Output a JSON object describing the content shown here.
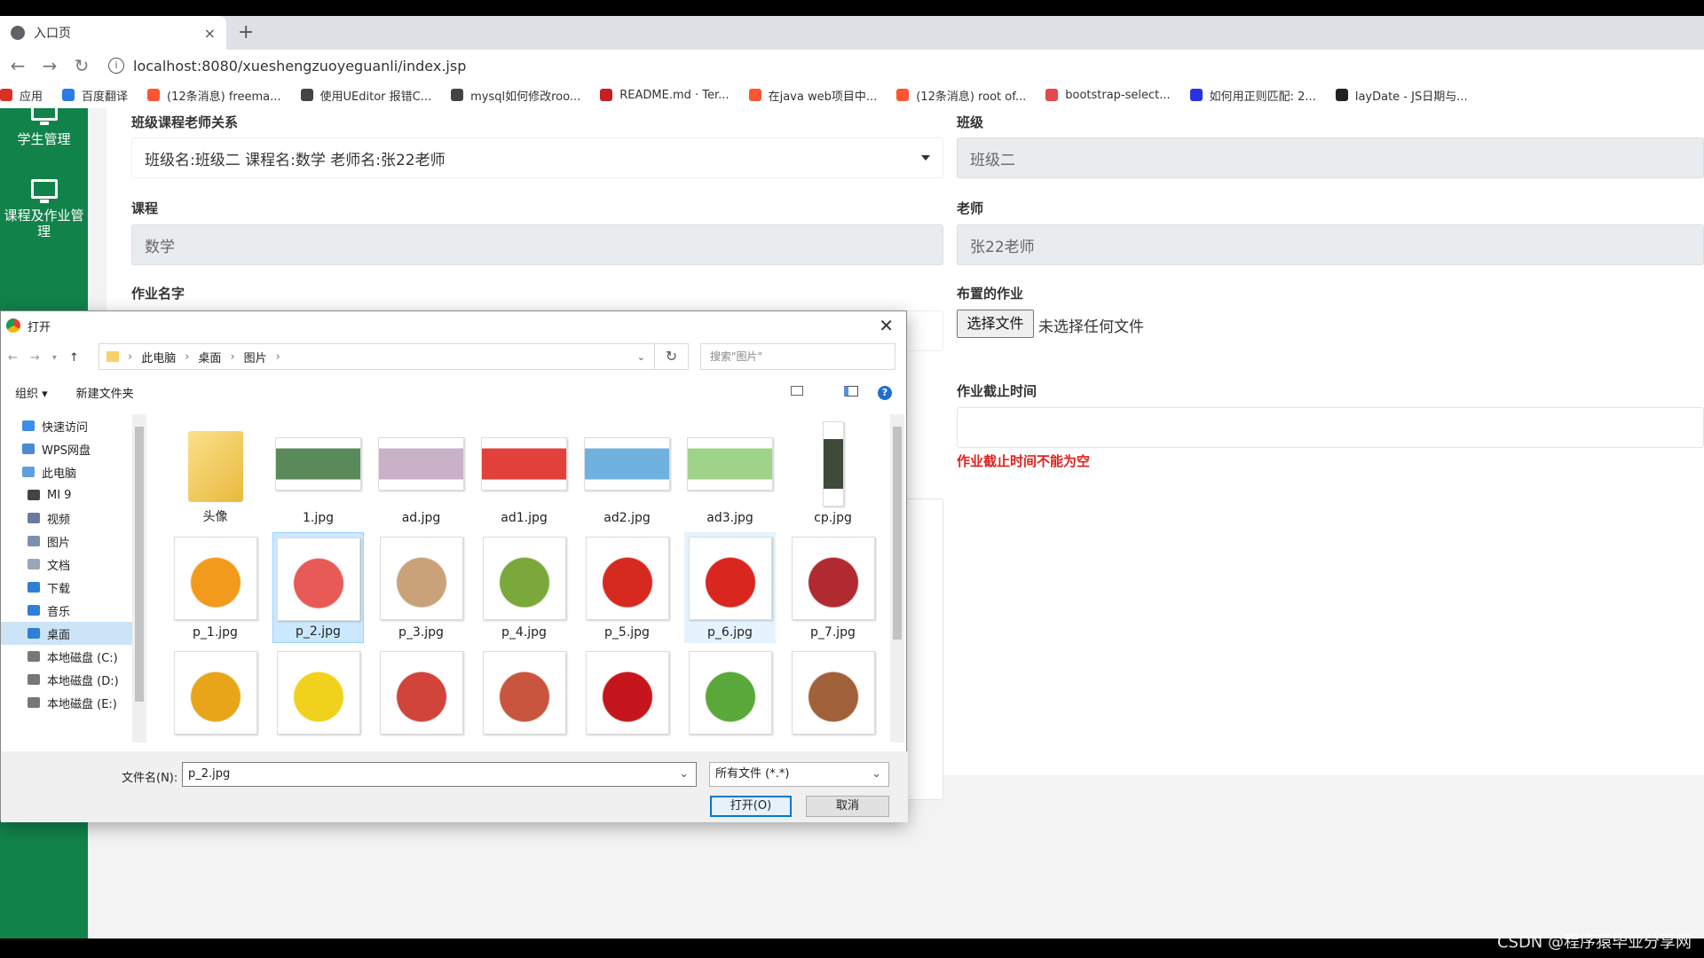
{
  "browser": {
    "tab_title": "入口页",
    "tab_close": "×",
    "new_tab": "+",
    "url": "localhost:8080/xueshengzuoyeguanli/index.jsp",
    "bookmarks": [
      {
        "label": "应用",
        "color": "#d93025"
      },
      {
        "label": "百度翻译",
        "color": "#2a7be4"
      },
      {
        "label": "(12条消息) freema...",
        "color": "#fc5531"
      },
      {
        "label": "使用UEditor 报错C...",
        "color": "#444444"
      },
      {
        "label": "mysql如何修改roo...",
        "color": "#444444"
      },
      {
        "label": "README.md · Ter...",
        "color": "#c71d23"
      },
      {
        "label": "在java web项目中...",
        "color": "#fc5531"
      },
      {
        "label": "(12条消息) root of...",
        "color": "#fc5531"
      },
      {
        "label": "bootstrap-select...",
        "color": "#e5484d"
      },
      {
        "label": "如何用正则匹配: 2...",
        "color": "#2932e1"
      },
      {
        "label": "layDate - JS日期与...",
        "color": "#222222"
      }
    ]
  },
  "sidebar": {
    "items": [
      {
        "label": "学生管理"
      },
      {
        "label": "课程及作业管理"
      }
    ]
  },
  "form": {
    "relation_label": "班级课程老师关系",
    "relation_value": "班级名:班级二 课程名:数学 老师名:张22老师",
    "class_label": "班级",
    "class_value": "班级二",
    "course_label": "课程",
    "course_value": "数学",
    "teacher_label": "老师",
    "teacher_value": "张22老师",
    "homework_name_label": "作业名字",
    "assigned_label": "布置的作业",
    "choose_file": "选择文件",
    "no_file": "未选择任何文件",
    "deadline_label": "作业截止时间",
    "deadline_error": "作业截止时间不能为空"
  },
  "dialog": {
    "title": "打开",
    "close": "✕",
    "path": [
      "此电脑",
      "桌面",
      "图片"
    ],
    "search_placeholder": "搜索\"图片\"",
    "organize": "组织 ▾",
    "new_folder": "新建文件夹",
    "help": "?",
    "nav": [
      {
        "label": "快速访问",
        "color": "#3d8ee8",
        "indent": 0
      },
      {
        "label": "WPS网盘",
        "color": "#4d88d6",
        "indent": 0
      },
      {
        "label": "此电脑",
        "color": "#5ea0da",
        "indent": 0
      },
      {
        "label": "MI 9",
        "color": "#444444",
        "indent": 1
      },
      {
        "label": "视频",
        "color": "#6b7aa0",
        "indent": 1
      },
      {
        "label": "图片",
        "color": "#7c8fb0",
        "indent": 1
      },
      {
        "label": "文档",
        "color": "#9aa6b8",
        "indent": 1
      },
      {
        "label": "下载",
        "color": "#2f7fd6",
        "indent": 1
      },
      {
        "label": "音乐",
        "color": "#2f7fd6",
        "indent": 1
      },
      {
        "label": "桌面",
        "color": "#2f7fd6",
        "indent": 1,
        "selected": true
      },
      {
        "label": "本地磁盘 (C:)",
        "color": "#777777",
        "indent": 1
      },
      {
        "label": "本地磁盘 (D:)",
        "color": "#777777",
        "indent": 1
      },
      {
        "label": "本地磁盘 (E:)",
        "color": "#777777",
        "indent": 1
      }
    ],
    "files": [
      {
        "name": "头像",
        "color": "#f3c64a",
        "kind": "folder"
      },
      {
        "name": "1.jpg",
        "color": "#5a8a5a",
        "kind": "wide"
      },
      {
        "name": "ad.jpg",
        "color": "#c9b2c8",
        "kind": "wide"
      },
      {
        "name": "ad1.jpg",
        "color": "#e2403a",
        "kind": "wide"
      },
      {
        "name": "ad2.jpg",
        "color": "#6fb2e0",
        "kind": "wide"
      },
      {
        "name": "ad3.jpg",
        "color": "#9fd38a",
        "kind": "wide"
      },
      {
        "name": "cp.jpg",
        "color": "#3f4a3a",
        "kind": "tall"
      },
      {
        "name": "p_1.jpg",
        "color": "#f29a1c",
        "kind": "square"
      },
      {
        "name": "p_2.jpg",
        "color": "#e85a55",
        "kind": "square",
        "selected": true
      },
      {
        "name": "p_3.jpg",
        "color": "#c9a27a",
        "kind": "square"
      },
      {
        "name": "p_4.jpg",
        "color": "#7aa83a",
        "kind": "square"
      },
      {
        "name": "p_5.jpg",
        "color": "#d62a20",
        "kind": "square"
      },
      {
        "name": "p_6.jpg",
        "color": "#d9261e",
        "kind": "square",
        "hover": true
      },
      {
        "name": "p_7.jpg",
        "color": "#b02a30",
        "kind": "square"
      },
      {
        "name": "",
        "color": "#e8a51a",
        "kind": "square"
      },
      {
        "name": "",
        "color": "#f0d21c",
        "kind": "square"
      },
      {
        "name": "",
        "color": "#d0443a",
        "kind": "square"
      },
      {
        "name": "",
        "color": "#c9553e",
        "kind": "square"
      },
      {
        "name": "",
        "color": "#c4161c",
        "kind": "square"
      },
      {
        "name": "",
        "color": "#5aa83a",
        "kind": "square"
      },
      {
        "name": "",
        "color": "#a0613a",
        "kind": "square"
      }
    ],
    "filename_label": "文件名(N):",
    "filename_value": "p_2.jpg",
    "filter_value": "所有文件 (*.*)",
    "open_button": "打开(O)",
    "cancel_button": "取消"
  },
  "watermark": "CSDN @程序猿毕业分享网"
}
